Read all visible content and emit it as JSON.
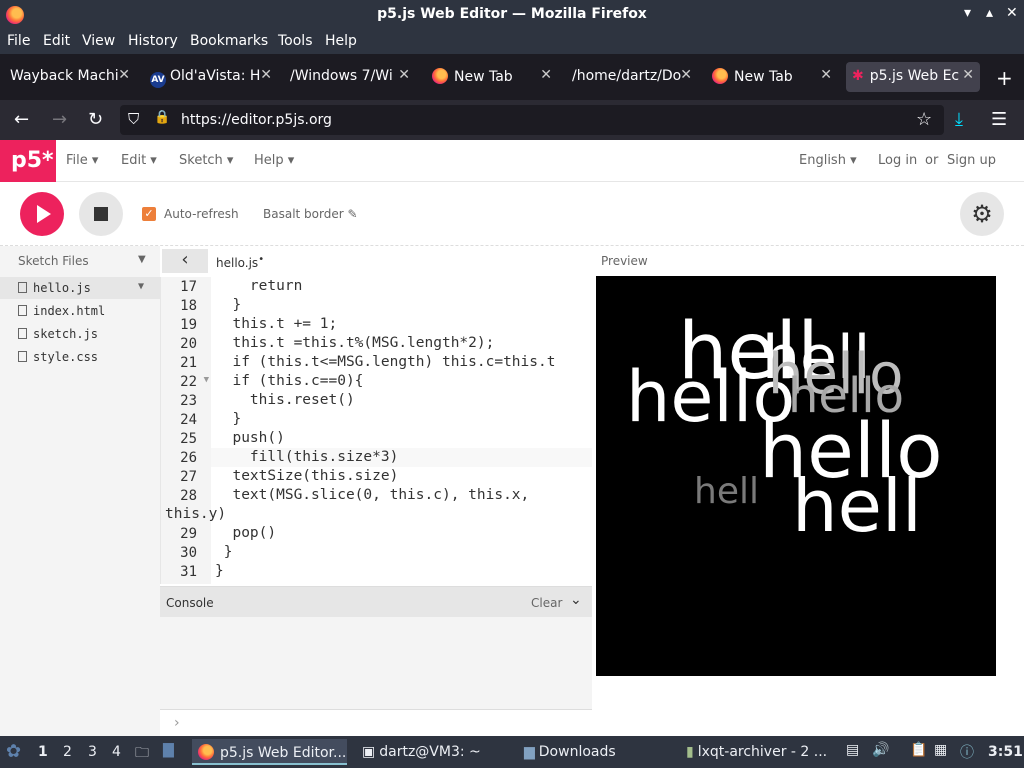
{
  "window": {
    "title": "p5.js Web Editor — Mozilla Firefox",
    "controls": [
      "▾",
      "▴",
      "✕"
    ]
  },
  "menubar": [
    "File",
    "Edit",
    "View",
    "History",
    "Bookmarks",
    "Tools",
    "Help"
  ],
  "tabs": [
    {
      "label": "Wayback Machi",
      "icon": "none",
      "active": false
    },
    {
      "label": "Old'aVista: H",
      "icon": "av",
      "active": false
    },
    {
      "label": "/Windows 7/Wi",
      "icon": "none",
      "active": false
    },
    {
      "label": "New Tab",
      "icon": "firefox",
      "active": false
    },
    {
      "label": "/home/dartz/Do",
      "icon": "none",
      "active": false
    },
    {
      "label": "New Tab",
      "icon": "firefox",
      "active": false
    },
    {
      "label": "p5.js Web Ec",
      "icon": "p5-star",
      "active": true
    }
  ],
  "tab_close": "✕",
  "new_tab": "+",
  "nav": {
    "url": "https://editor.p5js.org",
    "back": "←",
    "forward": "→",
    "reload": "↻",
    "shield": "⛉",
    "lock": "🔒",
    "bookmark": "☆",
    "download": "⤓",
    "menu": "☰"
  },
  "p5": {
    "logo": "p5*",
    "menu": [
      "File ▾",
      "Edit ▾",
      "Sketch ▾",
      "Help ▾"
    ],
    "language": "English ▾",
    "login": "Log in",
    "or": "or",
    "signup": "Sign up",
    "auto_refresh_label": "Auto-refresh",
    "auto_refresh_checked": "✓",
    "sketch_name": "Basalt border ✎",
    "gear": "⚙"
  },
  "sidebar": {
    "header": "Sketch Files",
    "header_arrow": "▼",
    "files": [
      {
        "name": "hello.js",
        "selected": true,
        "arrow": "▼"
      },
      {
        "name": "index.html",
        "selected": false
      },
      {
        "name": "sketch.js",
        "selected": false
      },
      {
        "name": "style.css",
        "selected": false
      }
    ]
  },
  "editor": {
    "collapse": "‹",
    "filename": "hello.js",
    "modified_dot": "•",
    "lines": [
      {
        "n": "17",
        "code": "    return"
      },
      {
        "n": "18",
        "code": "  }"
      },
      {
        "n": "19",
        "code": "  this.t += 1;"
      },
      {
        "n": "20",
        "code": "  this.t =this.t%(MSG.length*2);"
      },
      {
        "n": "21",
        "code": "  if (this.t<=MSG.length) this.c=this.t"
      },
      {
        "n": "22",
        "code": "  if (this.c==0){",
        "fold": "▼"
      },
      {
        "n": "23",
        "code": "    this.reset()"
      },
      {
        "n": "24",
        "code": "  }"
      },
      {
        "n": "25",
        "code": "  push()"
      },
      {
        "n": "26",
        "code": "    fill(this.size*3)"
      },
      {
        "n": "27",
        "code": "  textSize(this.size)"
      },
      {
        "n": "28",
        "code": "  text(MSG.slice(0, this.c), this.x,"
      },
      {
        "n": "",
        "code": "this.y)"
      },
      {
        "n": "29",
        "code": "  pop()"
      },
      {
        "n": "30",
        "code": " }"
      },
      {
        "n": "31",
        "code": "}"
      }
    ]
  },
  "console": {
    "title": "Console",
    "clear": "Clear",
    "chevron": "⌄",
    "prompt": "›"
  },
  "preview": {
    "label": "Preview",
    "words": [
      {
        "text": "hell",
        "size": 78,
        "color": "#ffffff"
      },
      {
        "text": "hello",
        "size": 70,
        "color": "#ffffff"
      },
      {
        "text": "hell",
        "size": 60,
        "color": "#ffffff"
      },
      {
        "text": "hello",
        "size": 56,
        "color": "#bdbdbd"
      },
      {
        "text": "hello",
        "size": 48,
        "color": "#a8a8a8"
      },
      {
        "text": "hello",
        "size": 76,
        "color": "#ffffff"
      },
      {
        "text": "hell",
        "size": 36,
        "color": "#7a7a7a"
      },
      {
        "text": "hell",
        "size": 72,
        "color": "#ffffff"
      }
    ]
  },
  "taskbar": {
    "workspaces": [
      "1",
      "2",
      "3",
      "4"
    ],
    "tasks": [
      {
        "label": "p5.js Web Editor...",
        "active": true
      },
      {
        "label": "dartz@VM3: ~",
        "active": false
      },
      {
        "label": "Downloads",
        "active": false
      },
      {
        "label": "lxqt-archiver - 2 ...",
        "active": false
      }
    ],
    "clock": "3:51"
  }
}
